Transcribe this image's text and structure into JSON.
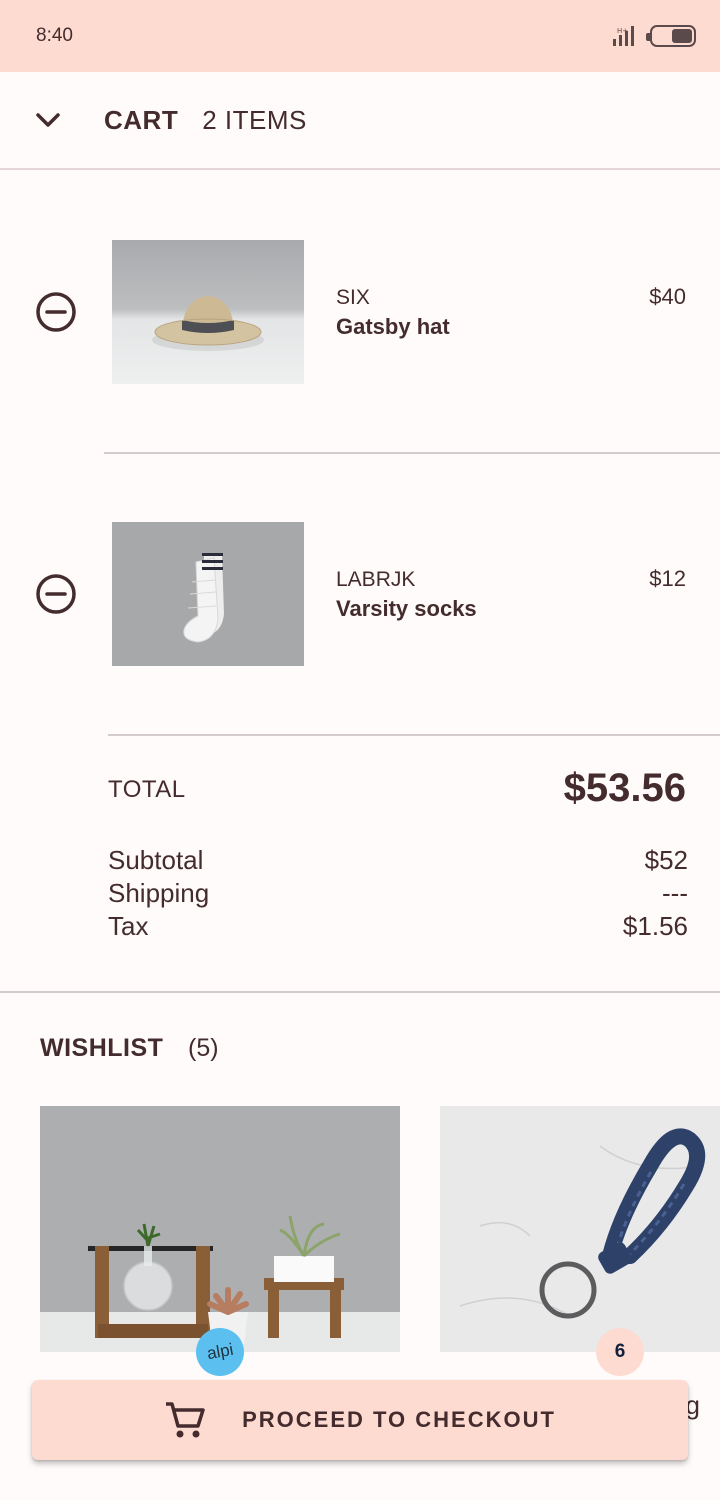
{
  "status_bar": {
    "time": "8:40",
    "signal_icon": "signal-icon",
    "battery_icon": "battery-icon"
  },
  "header": {
    "title": "CART",
    "count": "2 ITEMS",
    "collapse_icon": "chevron-down-icon"
  },
  "cart_items": [
    {
      "brand": "SIX",
      "name": "Gatsby hat",
      "price": "$40",
      "image": "hat-photo",
      "remove_icon": "remove-circle-icon"
    },
    {
      "brand": "LABRJK",
      "name": "Varsity socks",
      "price": "$12",
      "image": "socks-photo",
      "remove_icon": "remove-circle-icon"
    }
  ],
  "totals": {
    "total_label": "TOTAL",
    "total_value": "$53.56",
    "subtotal_label": "Subtotal",
    "subtotal_value": "$52",
    "shipping_label": "Shipping",
    "shipping_value": "---",
    "tax_label": "Tax",
    "tax_value": "$1.56"
  },
  "wishlist": {
    "title": "WISHLIST",
    "count": "(5)",
    "items": [
      {
        "image": "plant-stands-photo",
        "badge": "alpi"
      },
      {
        "image": "leather-keyring-photo",
        "badge": "6"
      }
    ],
    "partial_label": "g"
  },
  "checkout": {
    "label": "PROCEED TO CHECKOUT",
    "icon": "shopping-cart-icon"
  },
  "colors": {
    "primary": "#FEDBD0",
    "text": "#442C2E",
    "background": "#FFFBFA"
  }
}
